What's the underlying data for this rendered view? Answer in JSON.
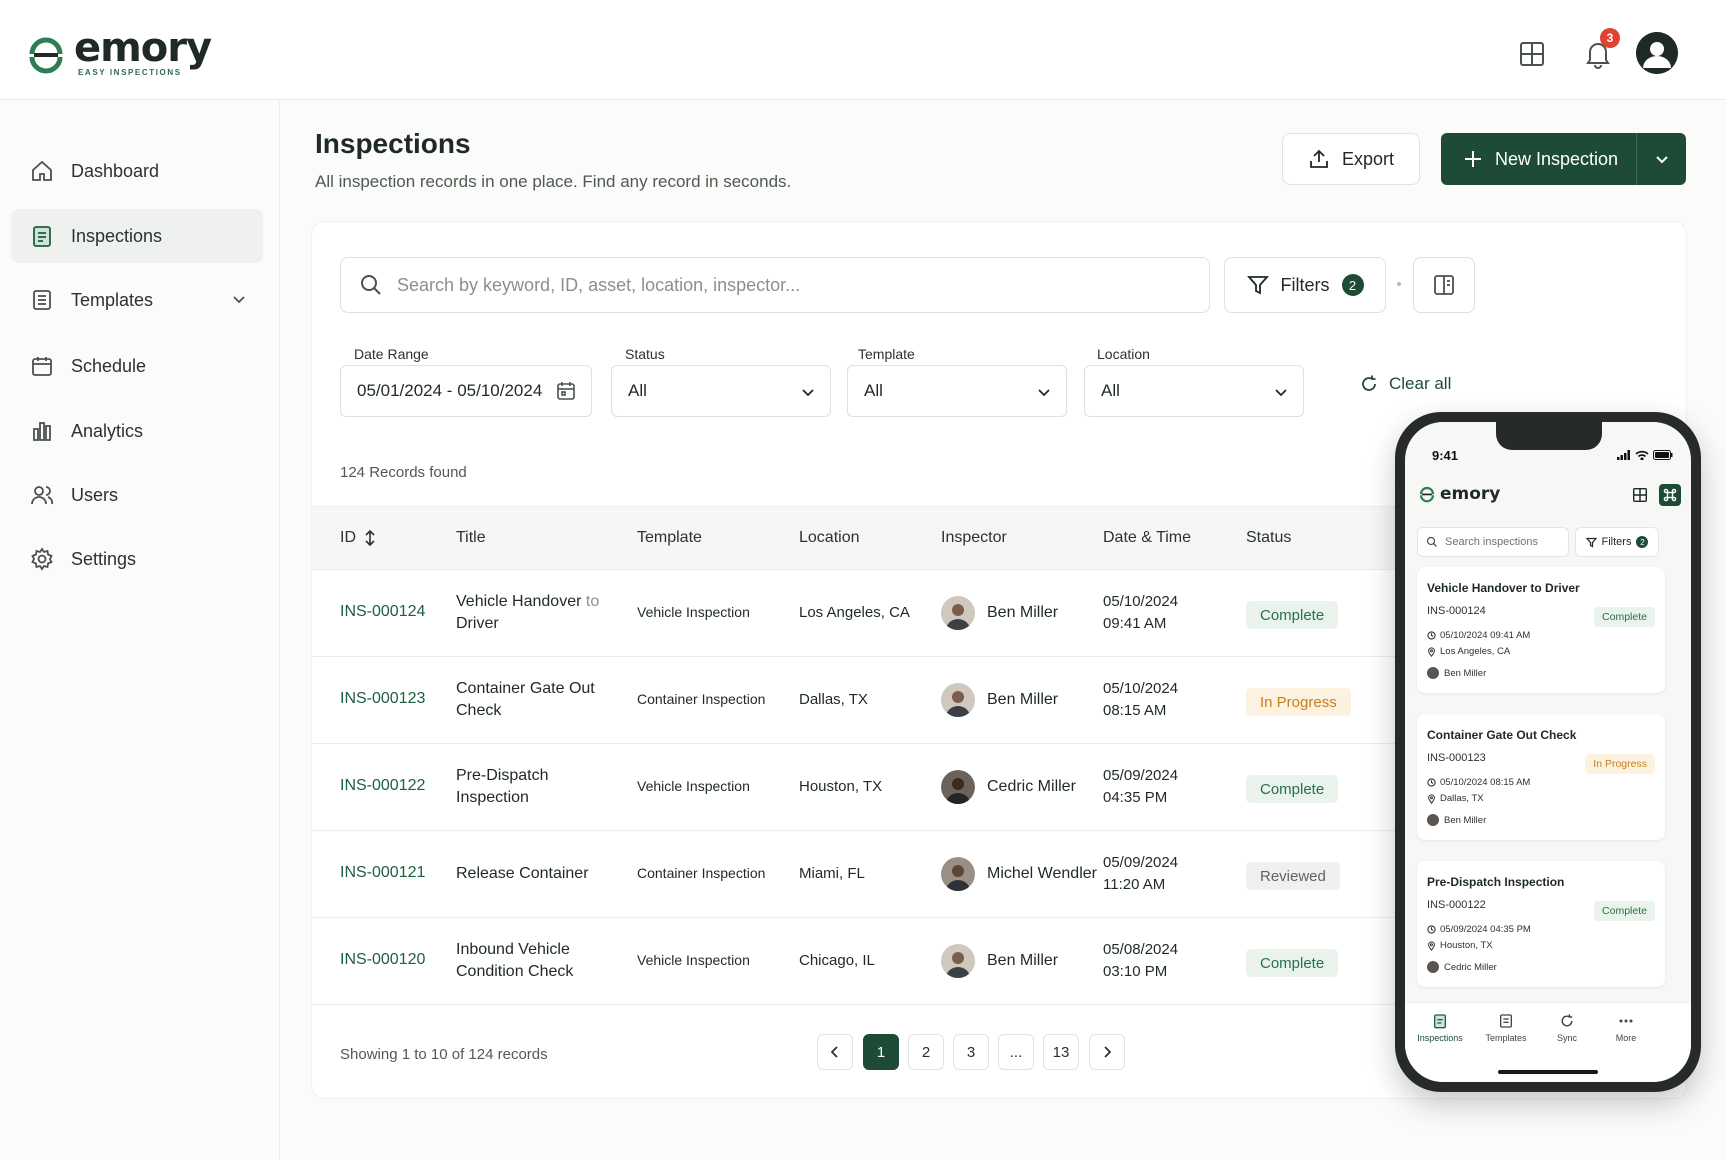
{
  "brand": {
    "name": "emory",
    "tagline": "EASY INSPECTIONS",
    "color": "#1e4b36"
  },
  "topbar": {
    "notification_count": "3"
  },
  "sidebar": {
    "items": [
      {
        "label": "Dashboard",
        "icon": "home-icon"
      },
      {
        "label": "Inspections",
        "icon": "clipboard-icon",
        "active": true
      },
      {
        "label": "Templates",
        "icon": "template-icon",
        "expandable": true
      },
      {
        "label": "Schedule",
        "icon": "calendar-icon"
      },
      {
        "label": "Analytics",
        "icon": "bar-chart-icon"
      },
      {
        "label": "Users",
        "icon": "users-icon"
      },
      {
        "label": "Settings",
        "icon": "gear-icon"
      }
    ]
  },
  "header": {
    "title": "Inspections",
    "subtitle": "All inspection records in one place. Find any record in seconds.",
    "export_label": "Export",
    "new_label": "New Inspection"
  },
  "search": {
    "placeholder": "Search by keyword, ID, asset, location, inspector..."
  },
  "filters": {
    "label": "Filters",
    "count": "2",
    "date_range": {
      "label": "Date Range",
      "value": "05/01/2024 - 05/10/2024"
    },
    "status": {
      "label": "Status",
      "value": "All"
    },
    "template": {
      "label": "Template",
      "value": "All"
    },
    "location": {
      "label": "Location",
      "value": "All"
    },
    "clear_label": "Clear all"
  },
  "records_found": "124 Records found",
  "table": {
    "columns": [
      "ID",
      "Title",
      "Template",
      "Location",
      "Inspector",
      "Date & Time",
      "Status"
    ],
    "rows": [
      {
        "id": "INS-000124",
        "title_a": "Vehicle Handover",
        "title_b": "to",
        "title_c": "Driver",
        "template": "Vehicle Inspection",
        "location": "Los Angeles, CA",
        "inspector": "Ben Miller",
        "date": "05/10/2024",
        "time": "09:41 AM",
        "status": "Complete"
      },
      {
        "id": "INS-000123",
        "title_a": "Container Gate Out",
        "title_b": "",
        "title_c": "Check",
        "template": "Container Inspection",
        "location": "Dallas, TX",
        "inspector": "Ben Miller",
        "date": "05/10/2024",
        "time": "08:15 AM",
        "status": "In Progress"
      },
      {
        "id": "INS-000122",
        "title_a": "Pre-Dispatch",
        "title_b": "",
        "title_c": "Inspection",
        "template": "Vehicle Inspection",
        "location": "Houston, TX",
        "inspector": "Cedric Miller",
        "date": "05/09/2024",
        "time": "04:35 PM",
        "status": "Complete"
      },
      {
        "id": "INS-000121",
        "title_a": "Release Container",
        "title_b": "",
        "title_c": "",
        "template": "Container Inspection",
        "location": "Miami, FL",
        "inspector": "Michel Wendler",
        "date": "05/09/2024",
        "time": "11:20 AM",
        "status": "Reviewed"
      },
      {
        "id": "INS-000120",
        "title_a": "Inbound Vehicle",
        "title_b": "",
        "title_c": "Condition Check",
        "template": "Vehicle Inspection",
        "location": "Chicago, IL",
        "inspector": "Ben Miller",
        "date": "05/08/2024",
        "time": "03:10 PM",
        "status": "Complete"
      }
    ]
  },
  "pagination": {
    "showing": "Showing 1 to 10 of 124 records",
    "pages": [
      "1",
      "2",
      "3",
      "...",
      "13"
    ],
    "current": "1"
  },
  "phone": {
    "time": "9:41",
    "brand": "emory",
    "search_placeholder": "Search inspections",
    "filters_label": "Filters",
    "filters_count": "2",
    "cards": [
      {
        "title": "Vehicle Handover to Driver",
        "id": "INS-000124",
        "datetime": "05/10/2024 09:41 AM",
        "location": "Los Angeles, CA",
        "inspector": "Ben Miller",
        "status": "Complete"
      },
      {
        "title": "Container Gate Out Check",
        "id": "INS-000123",
        "datetime": "05/10/2024 08:15 AM",
        "location": "Dallas, TX",
        "inspector": "Ben Miller",
        "status": "In Progress"
      },
      {
        "title": "Pre-Dispatch Inspection",
        "id": "INS-000122",
        "datetime": "05/09/2024 04:35 PM",
        "location": "Houston, TX",
        "inspector": "Cedric Miller",
        "status": "Complete"
      }
    ],
    "tabs": [
      "Inspections",
      "Templates",
      "Sync",
      "More"
    ]
  }
}
